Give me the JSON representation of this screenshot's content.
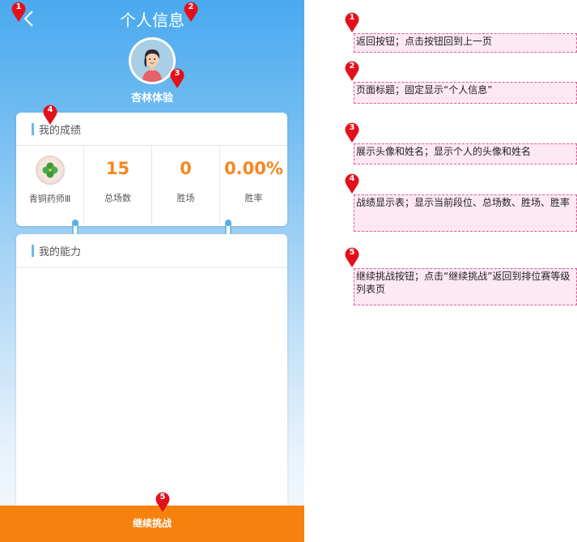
{
  "header": {
    "title": "个人信息"
  },
  "profile": {
    "name": "杏林体验"
  },
  "record_card": {
    "title": "我的成绩",
    "rank": {
      "label": "青铜药师Ⅲ"
    },
    "stats": [
      {
        "value": "15",
        "label": "总场数"
      },
      {
        "value": "0",
        "label": "胜场"
      },
      {
        "value": "0.00%",
        "label": "胜率"
      }
    ]
  },
  "ability_card": {
    "title": "我的能力"
  },
  "continue_button": {
    "label": "继续挑战"
  },
  "markers": [
    "1",
    "2",
    "3",
    "4",
    "5"
  ],
  "notes": [
    "返回按钮；点击按钮回到上一页",
    "页面标题；固定显示“个人信息”",
    "展示头像和姓名；显示个人的头像和姓名",
    "战绩显示表；显示当前段位、总场数、胜场、胜率",
    "继续挑战按钮；点击“继续挑战”返回到排位赛等级列表页"
  ],
  "colors": {
    "accent_blue": "#4aa9ef",
    "button_orange": "#f5820e",
    "stat_orange": "#f5871f",
    "marker_red": "#e3101c",
    "note_border": "#e05a9a",
    "note_bg": "#fde8f3"
  },
  "icons": {
    "back": "chevron-left-icon",
    "rank": "clover-icon",
    "avatar": "user-avatar-icon",
    "marker": "map-pin-icon"
  }
}
